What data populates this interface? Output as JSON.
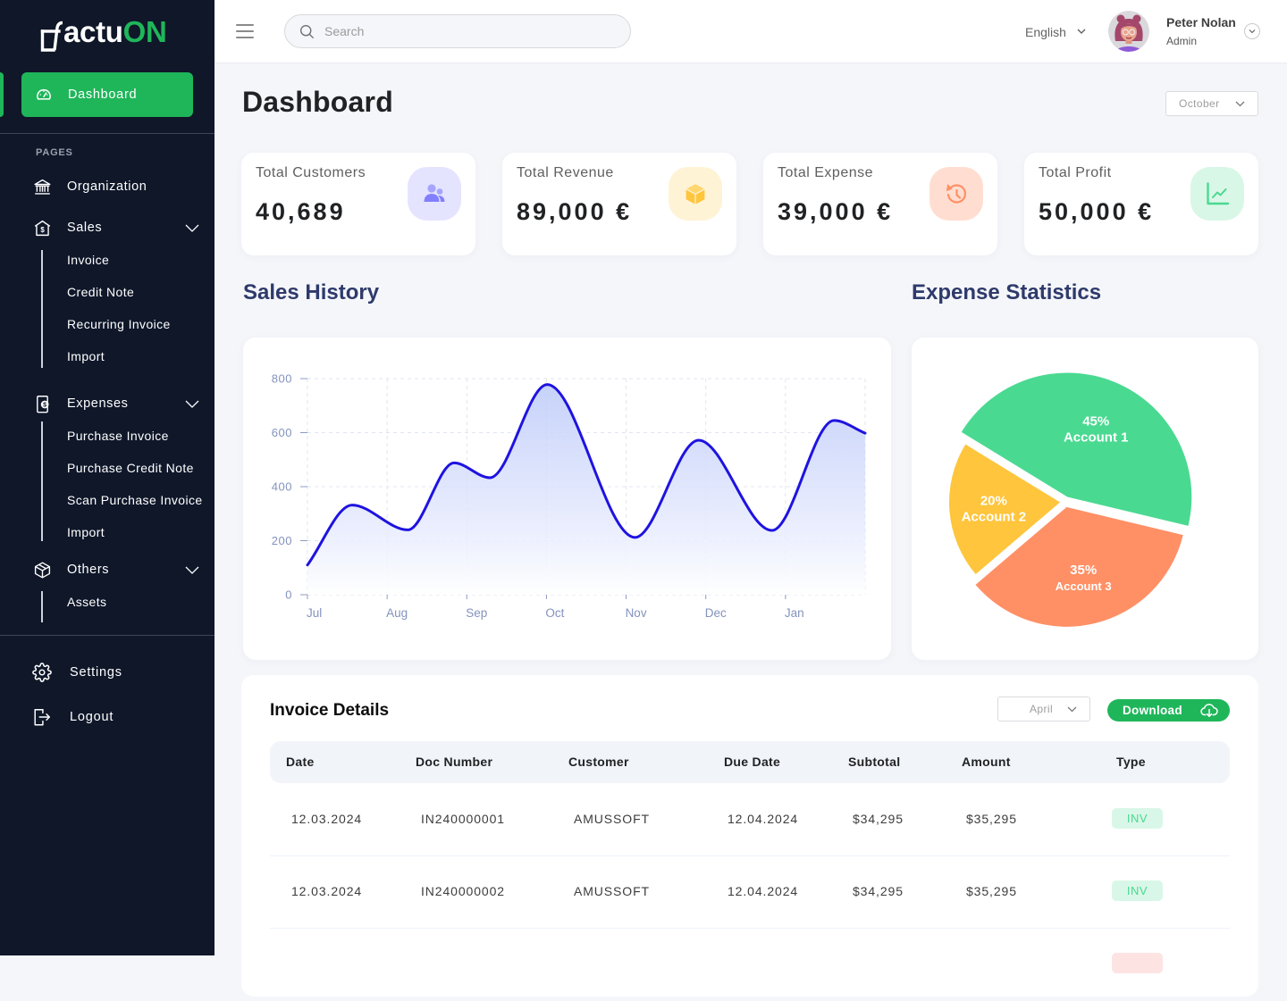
{
  "theme": {
    "accent": "#1fb65a",
    "sidebar_bg": "#0f1729",
    "page_bg": "#f5f6fa",
    "heading_color": "#2e3a6b"
  },
  "brand": {
    "mark": "f",
    "name_part1": "actu",
    "name_part2": "ON"
  },
  "sidebar": {
    "active_item": {
      "label": "Dashboard",
      "icon": "gauge-icon"
    },
    "section_label": "PAGES",
    "items": [
      {
        "label": "Organization",
        "icon": "bank-icon"
      },
      {
        "label": "Sales",
        "icon": "house-dollar-icon",
        "expanded": true,
        "children": [
          "Invoice",
          "Credit Note",
          "Recurring Invoice",
          "Import"
        ]
      },
      {
        "label": "Expenses",
        "icon": "mobile-dollar-icon",
        "expanded": true,
        "children": [
          "Purchase Invoice",
          "Purchase Credit Note",
          "Scan Purchase Invoice",
          "Import"
        ]
      },
      {
        "label": "Others",
        "icon": "box-icon",
        "expanded": true,
        "children": [
          "Assets"
        ]
      }
    ],
    "footer_items": [
      {
        "label": "Settings",
        "icon": "gear-icon"
      },
      {
        "label": "Logout",
        "icon": "logout-icon"
      }
    ]
  },
  "header": {
    "search_placeholder": "Search",
    "language": "English",
    "user": {
      "name": "Peter Nolan",
      "role": "Admin"
    }
  },
  "page": {
    "title": "Dashboard",
    "month_filter": "October"
  },
  "stats": [
    {
      "label": "Total Customers",
      "value": "40,689",
      "icon": "users-icon",
      "color": "#8280ff",
      "bg": "#e5e4ff"
    },
    {
      "label": "Total Revenue",
      "value": "89,000 €",
      "icon": "cube-icon",
      "color": "#fec53d",
      "bg": "#fff3d6"
    },
    {
      "label": "Total Expense",
      "value": "39,000 €",
      "icon": "history-icon",
      "color": "#ff9066",
      "bg": "#ffded1"
    },
    {
      "label": "Total Profit",
      "value": "50,000 €",
      "icon": "line-chart-icon",
      "color": "#4ad991",
      "bg": "#d9f7e7"
    }
  ],
  "sections": {
    "sales_history": "Sales History",
    "expense_statistics": "Expense Statistics"
  },
  "chart_data": [
    {
      "type": "area",
      "title": "Sales History",
      "x_categories": [
        "Jul",
        "Aug",
        "Sep",
        "Oct",
        "Nov",
        "Dec",
        "Jan"
      ],
      "xlim": [
        0,
        7
      ],
      "ylim": [
        0,
        800
      ],
      "yticks": [
        0,
        200,
        400,
        600,
        800
      ],
      "grid": true,
      "xlabel": "",
      "ylabel": "",
      "series": [
        {
          "name": "Sales",
          "color": "#1e13e0",
          "x": [
            0,
            0.56,
            1.26,
            1.84,
            2.29,
            3.01,
            4.11,
            4.91,
            5.83,
            6.61,
            7.0
          ],
          "y": [
            110,
            332,
            240,
            488,
            433,
            778,
            212,
            572,
            238,
            645,
            598
          ]
        }
      ]
    },
    {
      "type": "pie",
      "title": "Expense Statistics",
      "labels": [
        "Account 1",
        "Account 2",
        "Account 3"
      ],
      "values": [
        45,
        20,
        35
      ],
      "value_labels": [
        "45%",
        "20%",
        "35%"
      ],
      "colors": [
        "#4ad991",
        "#fec53d",
        "#ff9066"
      ]
    }
  ],
  "invoices": {
    "title": "Invoice Details",
    "month_filter": "April",
    "download_label": "Download",
    "columns": [
      "Date",
      "Doc Number",
      "Customer",
      "Due Date",
      "Subtotal",
      "Amount",
      "Type"
    ],
    "rows": [
      {
        "date": "12.03.2024",
        "doc_number": "IN240000001",
        "customer": "AMUSSOFT",
        "due_date": "12.04.2024",
        "subtotal": "$34,295",
        "amount": "$35,295",
        "type": "INV"
      },
      {
        "date": "12.03.2024",
        "doc_number": "IN240000002",
        "customer": "AMUSSOFT",
        "due_date": "12.04.2024",
        "subtotal": "$34,295",
        "amount": "$35,295",
        "type": "INV"
      }
    ]
  }
}
